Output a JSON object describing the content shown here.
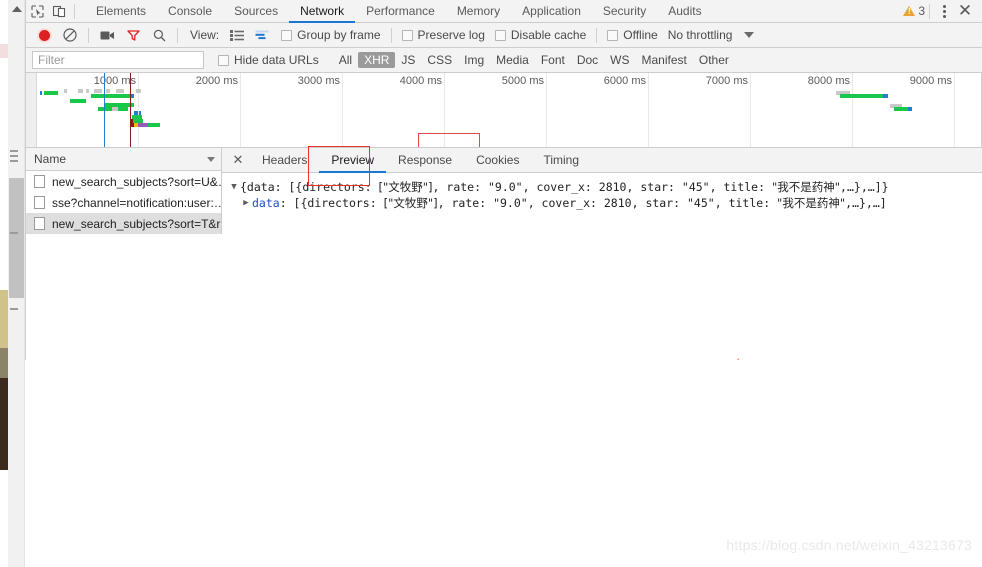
{
  "devtools": {
    "icons": {
      "inspect": "inspect-element-icon",
      "device": "device-toolbar-icon"
    },
    "tabs": [
      {
        "label": "Elements",
        "active": false
      },
      {
        "label": "Console",
        "active": false
      },
      {
        "label": "Sources",
        "active": false
      },
      {
        "label": "Network",
        "active": true
      },
      {
        "label": "Performance",
        "active": false
      },
      {
        "label": "Memory",
        "active": false
      },
      {
        "label": "Application",
        "active": false
      },
      {
        "label": "Security",
        "active": false
      },
      {
        "label": "Audits",
        "active": false
      }
    ],
    "warning_count": "3",
    "more_label": "⋮",
    "close_label": "✕"
  },
  "network_toolbar": {
    "record_title": "record-button",
    "clear_title": "clear-button",
    "capture_screenshots_title": "camera-button",
    "filter_title": "filter-button",
    "search_title": "search-button",
    "view_label": "View:",
    "group_by_frame_label": "Group by frame",
    "preserve_log_label": "Preserve log",
    "disable_cache_label": "Disable cache",
    "offline_label": "Offline",
    "throttling_value": "No throttling"
  },
  "filter_row": {
    "placeholder": "Filter",
    "value": "",
    "hide_data_urls_label": "Hide data URLs",
    "types": [
      {
        "label": "All",
        "active": false
      },
      {
        "label": "XHR",
        "active": true
      },
      {
        "label": "JS",
        "active": false
      },
      {
        "label": "CSS",
        "active": false
      },
      {
        "label": "Img",
        "active": false
      },
      {
        "label": "Media",
        "active": false
      },
      {
        "label": "Font",
        "active": false
      },
      {
        "label": "Doc",
        "active": false
      },
      {
        "label": "WS",
        "active": false
      },
      {
        "label": "Manifest",
        "active": false
      },
      {
        "label": "Other",
        "active": false
      }
    ]
  },
  "overview": {
    "ticks": [
      "1000 ms",
      "2000 ms",
      "3000 ms",
      "4000 ms",
      "5000 ms",
      "6000 ms",
      "7000 ms",
      "8000 ms",
      "9000 ms"
    ],
    "domcontentloaded_color": "#1f7fd0",
    "load_color": "#8b1a1a",
    "bar_color": "#19c74a",
    "wait_color": "#c8c8c8",
    "ssl_color": "#9b59b6",
    "ttfb_color": "#f5b800",
    "download_color": "#1f7fd0"
  },
  "request_list": {
    "column_header": "Name",
    "rows": [
      {
        "name": "new_search_subjects?sort=U&…",
        "selected": false
      },
      {
        "name": "sse?channel=notification:user:…",
        "selected": false
      },
      {
        "name": "new_search_subjects?sort=T&r…",
        "selected": true
      }
    ]
  },
  "detail_panel": {
    "close_label": "✕",
    "tabs": [
      {
        "label": "Headers",
        "active": false
      },
      {
        "label": "Preview",
        "active": true
      },
      {
        "label": "Response",
        "active": false
      },
      {
        "label": "Cookies",
        "active": false
      },
      {
        "label": "Timing",
        "active": false
      }
    ],
    "highlighted_tab": "Preview",
    "preview": {
      "line1": {
        "triangle": "▼",
        "open": "{data: [{",
        "key_directors": "directors",
        "directors_value": "[\"文牧野\"]",
        "key_rate": "rate",
        "rate_value": "\"9.0\"",
        "key_cover_x": "cover_x",
        "cover_x_value": "2810",
        "key_star": "star",
        "star_value": "\"45\"",
        "key_title": "title",
        "title_value": "\"我不是药神\"",
        "tail": ",…},…]}"
      },
      "line2": {
        "triangle": "▶",
        "key_data": "data",
        "open": ": [{",
        "key_directors": "directors",
        "directors_value": "[\"文牧野\"]",
        "key_rate": "rate",
        "rate_value": "\"9.0\"",
        "key_cover_x": "cover_x",
        "cover_x_value": "2810",
        "key_star": "star",
        "star_value": "\"45\"",
        "key_title": "title",
        "title_value": "\"我不是药神\"",
        "tail": ",…},…]"
      }
    }
  },
  "annotations": {
    "arrow_color": "#f23b2f",
    "box_color": "#e8322a",
    "arrow_points_to": "rate value \"9.0\""
  },
  "watermark": {
    "text": "https://blog.csdn.net/weixin_43213673"
  }
}
